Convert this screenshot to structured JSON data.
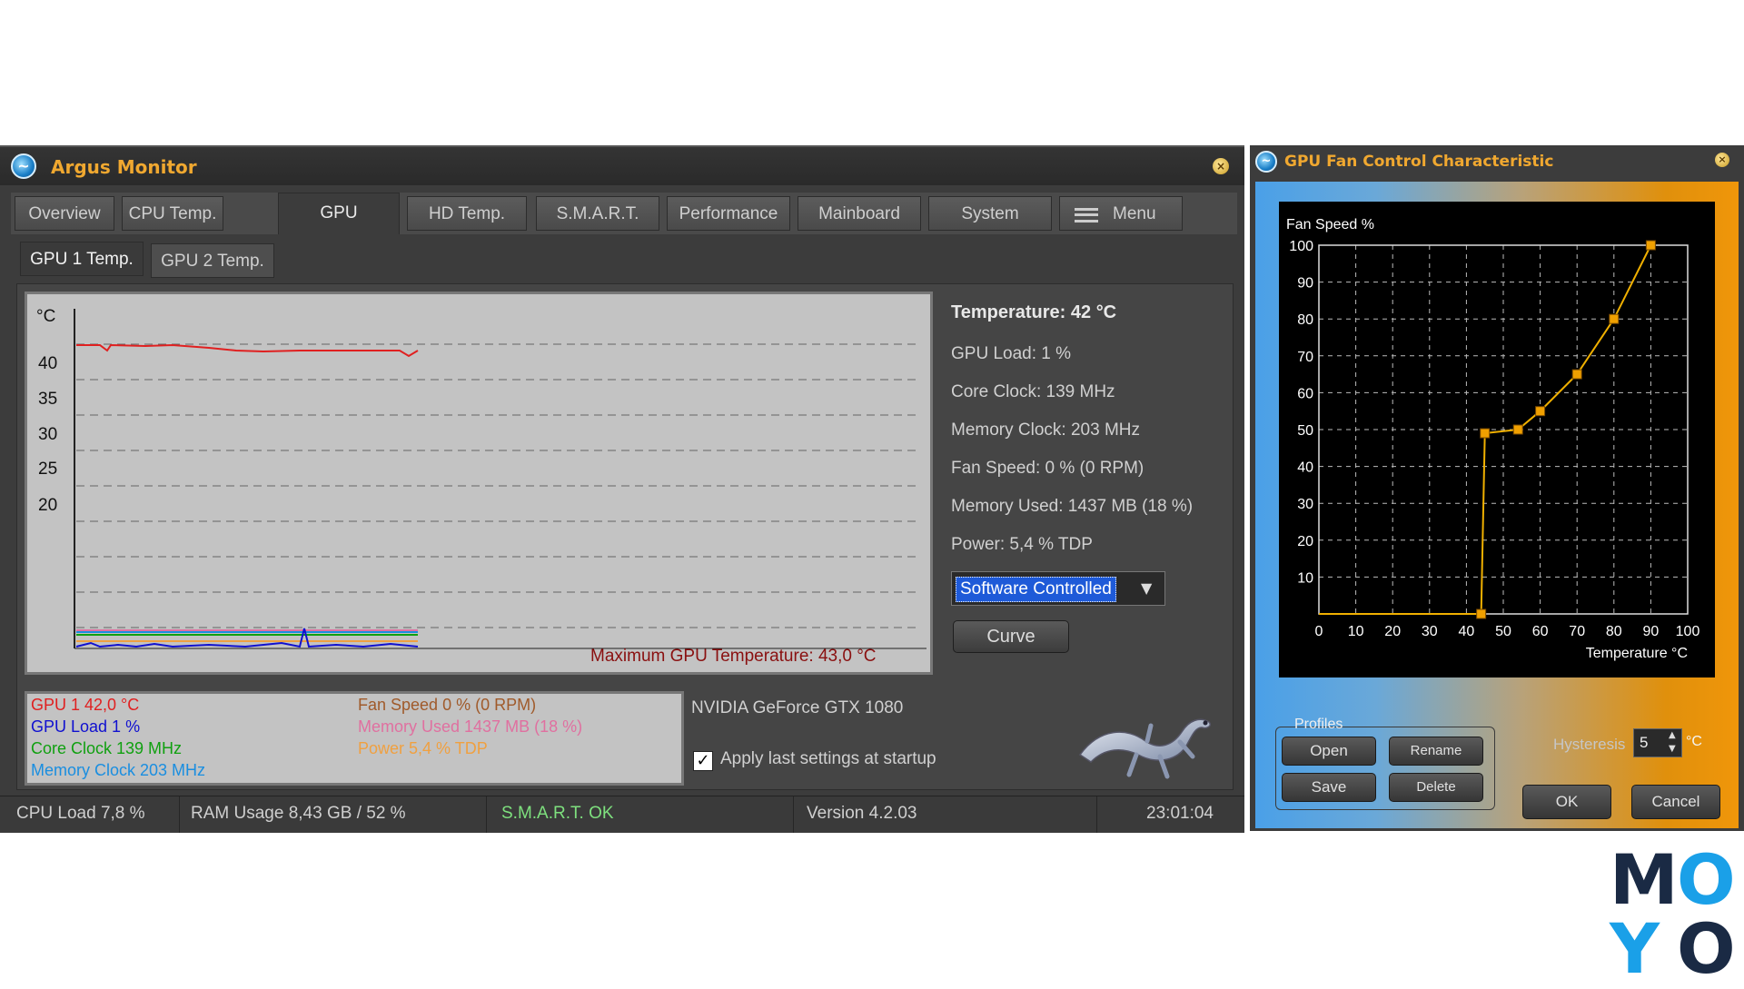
{
  "argus": {
    "title": "Argus Monitor",
    "tabs": [
      "Overview",
      "CPU Temp.",
      "GPU",
      "HD Temp.",
      "S.M.A.R.T.",
      "Performance",
      "Mainboard",
      "System"
    ],
    "active_tab": "GPU",
    "menu_label": "Menu",
    "subtabs": [
      "GPU 1 Temp.",
      "GPU 2 Temp."
    ],
    "active_subtab": "GPU 1 Temp.",
    "graph": {
      "unit_label": "°C",
      "y_ticks": [
        "40",
        "35",
        "30",
        "25",
        "20"
      ],
      "max_label": "Maximum GPU Temperature: 43,0 °C"
    },
    "info": {
      "temperature": "Temperature: 42 °C",
      "gpu_load": "GPU Load: 1 %",
      "core_clock": "Core Clock: 139 MHz",
      "memory_clock": "Memory Clock: 203 MHz",
      "fan_speed": "Fan Speed: 0 % (0 RPM)",
      "memory_used": "Memory Used: 1437 MB (18 %)",
      "power": "Power: 5,4 % TDP"
    },
    "fan_mode": "Software Controlled",
    "curve_button": "Curve",
    "legend": {
      "gpu_temp": "GPU 1 42,0 °C",
      "gpu_load": "GPU Load 1 %",
      "core_clock": "Core Clock 139 MHz",
      "memory_clock": "Memory Clock 203 MHz",
      "fan_speed": "Fan Speed 0 %  (0 RPM)",
      "memory_used": "Memory Used 1437 MB  (18 %)",
      "power": "Power 5,4 % TDP"
    },
    "gpu_name": "NVIDIA GeForce GTX 1080",
    "apply_startup_label": "Apply last settings at startup",
    "apply_startup_checked": true,
    "status": {
      "cpu_load": "CPU Load 7,8 %",
      "ram_usage": "RAM Usage 8,43 GB / 52 %",
      "smart": "S.M.A.R.T. OK",
      "version": "Version 4.2.03",
      "time": "23:01:04"
    },
    "colors": {
      "gpu_temp": "#e02020",
      "gpu_load": "#1010d0",
      "core_clock": "#10a010",
      "memory_clock": "#1a8ee0",
      "fan_speed": "#a05a2a",
      "memory_used": "#e070a0",
      "power": "#f0a040",
      "title": "#f0a830",
      "smart_ok": "#7ee07e"
    }
  },
  "fan_window": {
    "title": "GPU Fan Control Characteristic",
    "profiles_label": "Profiles",
    "buttons": {
      "open": "Open",
      "rename": "Rename",
      "save": "Save",
      "delete": "Delete",
      "ok": "OK",
      "cancel": "Cancel"
    },
    "hysteresis_label": "Hysteresis",
    "hysteresis_value": "5",
    "hysteresis_unit": "°C"
  },
  "chart_data": {
    "type": "line",
    "ylabel": "Fan Speed %",
    "xlabel": "Temperature °C",
    "xlim": [
      0,
      100
    ],
    "ylim": [
      0,
      100
    ],
    "x_ticks": [
      "0",
      "10",
      "20",
      "30",
      "40",
      "50",
      "60",
      "70",
      "80",
      "90",
      "100"
    ],
    "y_ticks": [
      "10",
      "20",
      "30",
      "40",
      "50",
      "60",
      "70",
      "80",
      "90",
      "100"
    ],
    "grid": true,
    "points": [
      {
        "x": 0,
        "y": 0
      },
      {
        "x": 44,
        "y": 0
      },
      {
        "x": 45,
        "y": 49
      },
      {
        "x": 54,
        "y": 50
      },
      {
        "x": 60,
        "y": 55
      },
      {
        "x": 70,
        "y": 65
      },
      {
        "x": 80,
        "y": 80
      },
      {
        "x": 90,
        "y": 100
      }
    ],
    "markers_from_index": 1
  },
  "watermark": {
    "letters": [
      "M",
      "O",
      "Y",
      "O"
    ],
    "colors": [
      "#1a2a44",
      "#1aa0e8",
      "#1aa0e8",
      "#1a2a44"
    ]
  }
}
